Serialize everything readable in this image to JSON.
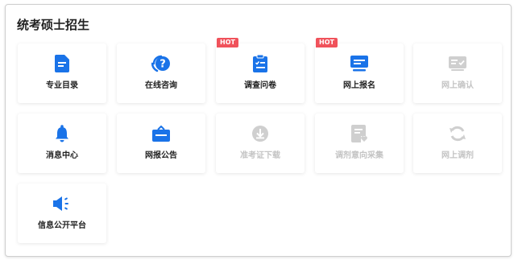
{
  "section": {
    "title": "统考硕士招生"
  },
  "colors": {
    "active": "#1a73e8",
    "disabled": "#cfcfcf",
    "hot_badge": "#f0525b"
  },
  "tiles": [
    {
      "label": "专业目录",
      "icon": "document-list-icon",
      "enabled": true,
      "badge": ""
    },
    {
      "label": "在线咨询",
      "icon": "question-bubble-icon",
      "enabled": true,
      "badge": ""
    },
    {
      "label": "调查问卷",
      "icon": "clipboard-checklist-icon",
      "enabled": true,
      "badge": "HOT"
    },
    {
      "label": "网上报名",
      "icon": "monitor-icon",
      "enabled": true,
      "badge": "HOT"
    },
    {
      "label": "网上确认",
      "icon": "id-card-check-icon",
      "enabled": false,
      "badge": ""
    },
    {
      "label": "消息中心",
      "icon": "bell-icon",
      "enabled": true,
      "badge": ""
    },
    {
      "label": "网报公告",
      "icon": "briefcase-icon",
      "enabled": true,
      "badge": ""
    },
    {
      "label": "准考证下载",
      "icon": "download-circle-icon",
      "enabled": false,
      "badge": ""
    },
    {
      "label": "调剂意向采集",
      "icon": "document-heart-icon",
      "enabled": false,
      "badge": ""
    },
    {
      "label": "网上调剂",
      "icon": "refresh-icon",
      "enabled": false,
      "badge": ""
    },
    {
      "label": "信息公开平台",
      "icon": "megaphone-icon",
      "enabled": true,
      "badge": ""
    }
  ]
}
